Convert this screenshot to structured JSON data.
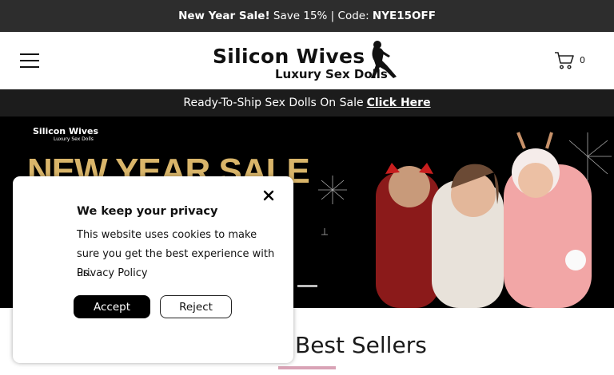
{
  "announcement": {
    "sale": "New Year Sale!",
    "save": "Save 15%",
    "sep": "|",
    "code_label": "Code:",
    "code": "NYE15OFF"
  },
  "header": {
    "logo_title": "Silicon Wives",
    "logo_sub": "Luxury Sex Dolls",
    "cart_count": "0"
  },
  "ship_bar": {
    "text": "Ready-To-Ship Sex Dolls On Sale",
    "link": "Click Here"
  },
  "hero": {
    "logo_title": "Silicon Wives",
    "logo_sub": "Luxury Sex Dolls",
    "headline": "NEW YEAR SALE",
    "colors": {
      "headline": "#d9b56a",
      "background": "#000000"
    }
  },
  "section": {
    "title": "Best Sellers",
    "underline_color": "#d9a3b6"
  },
  "cookie": {
    "title": "We keep your privacy",
    "text": "This website uses cookies to make sure you get the best experience with us.",
    "policy": "Privacy Policy",
    "accept": "Accept",
    "reject": "Reject"
  },
  "icons": [
    "hamburger-icon",
    "cart-icon",
    "close-icon",
    "logo-figure-icon"
  ]
}
